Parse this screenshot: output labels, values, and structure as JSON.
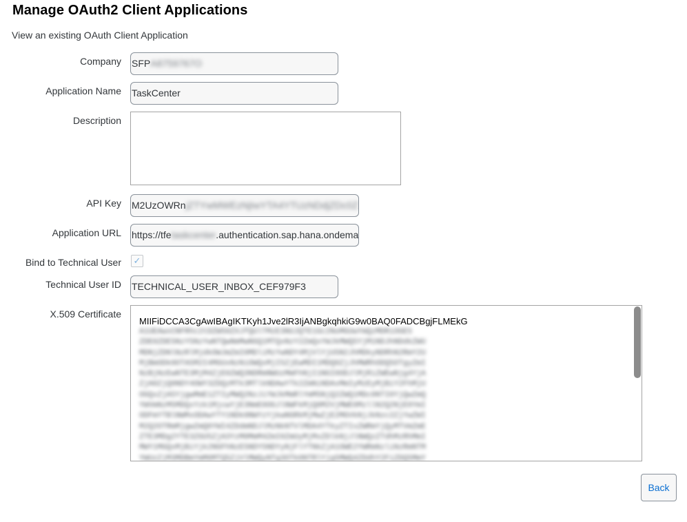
{
  "page": {
    "title": "Manage OAuth2 Client Applications",
    "subtitle": "View an existing OAuth Client Application"
  },
  "form": {
    "company": {
      "label": "Company",
      "value_visible": "SFP",
      "value_redacted": "A8759767O"
    },
    "application_name": {
      "label": "Application Name",
      "value": "TaskCenter"
    },
    "description": {
      "label": "Description",
      "value": ""
    },
    "api_key": {
      "label": "API Key",
      "value_visible": "M2UzOWRn",
      "value_redacted": "jZTYwMWEzNjIwYTA4YTUzNDdjZDc0Z",
      "value_tail": "A"
    },
    "application_url": {
      "label": "Application URL",
      "value_prefix": "https://tfe",
      "value_redacted": "taskcenter",
      "value_suffix": ".authentication.sap.hana.ondema"
    },
    "bind_technical_user": {
      "label": "Bind to Technical User",
      "checked": true,
      "check_glyph": "✓"
    },
    "technical_user_id": {
      "label": "Technical User ID",
      "value": "TECHNICAL_USER_INBOX_CEF979F3"
    },
    "certificate": {
      "label": "X.509 Certificate",
      "first_line": "MIIFiDCCA3CgAwIBAgIKTKyh1Jve2lR3IjANBgkqhkiG9w0BAQ0FADCBgjFLMEkG",
      "redacted_text": "A1UEAwxCNFRhc2tDZW50ZXJfQUlTMzE3NUJQTE1Gc2NoMGUwYmQzMDRiOGE5\nZDE0ZDE5NzY5NzYwNTQwNmMwNGQ1MTQxNzY2ZmQxYWJkMWQ5YjM1NDJhNDdkZWU\nMDNjZDNlNzRlMjdkOWJmZmI0MDliMzYwNDY4MjVlYjU5N2JhMDkyNDRhN2RmY2U\nMjBmODk0OTA5M2I4MGUxNzNiOWQxMjI5ZjEwMDI1MDQ0ZjJhMWRhODQ5OTgyZmI\nNzBjNzEwNTE3MjM4ZjE0ZWQ3NDRmNWUzMmFhNjI1NGI0ODJlMjRiZWEwNjg4YjA\nZjA0ZjQ0NDY4OWY3ZDQzMTk3MTlkNDAwYTk2ZmNiNDAxMmIyMzEyMjBiY2FhMjU\nOGQxZjA5YjgwMmE1ZTIyMWQ2NzJiYWJkMmRlYmM5NjQ2ZWQ1MDc0NTI0YjQwZmQ\nYWVmNzM5MDQxYzk1MjcwYjE3NmE0OGJlNWFkMjQ0M2VjMWE0MzllN2Q2NjE0YmI\nODFmYTBlNWMxODAwYTY1NDk0NWYzYjkwNGRkMjMwZjE2MGVkNjJkNzc2ZjYwZWI\nM2Q2OTRmMjgwZmQ0YWI4ZDdmNDJlMzNkNTVlMDA4YTkyZTIxZWRmYjQyMTVmZmE\nZTE3MDg2YTE3ZGU5ZjA3YzM0MmM4ZmI0ZmUyMjMxZDlkNjJlNWQzZTdhMzRhMmI\nMWY1MGQxMjBiYjk2NGFhNzE5NDY5NDYyNjFlYTNkZjA1OWE2YWRmNzliNzRmNTM\nYWUzZjM3MDBmYmM0MTQ5ZjVlMWQyNTg3OTk0NTRlYjg5MWQ4ZDdhY2FiZDQ5MmY\nNzA1ZTQyYmQ4ZTA4ZmVkNDYxZTdkYTAwOWQ4ZGJjOWZkZjQxNTQ3OTQ2ZDhhZmE\nYjE2NDg2YjEwZWY4N2I1Y2M0YTY0OWI1ZjFmNTYyNWEyZjZkNzVmYjI3YmM5Y2Y"
    }
  },
  "actions": {
    "back_label": "Back"
  },
  "colors": {
    "title": "#000000",
    "text": "#32363a",
    "field_border": "#89919a",
    "field_bg": "#f7f7f7",
    "button_text": "#0a6ed1",
    "check": "#7fb3e0"
  }
}
